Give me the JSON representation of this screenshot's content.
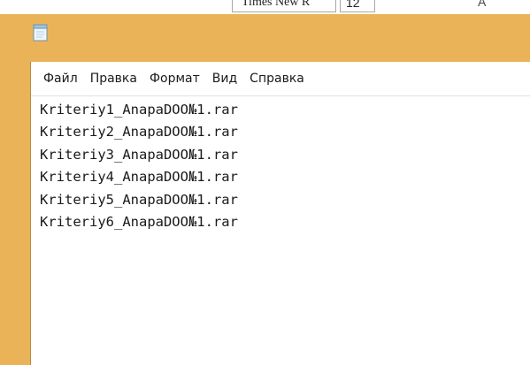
{
  "background_app": {
    "font_combo_value": "Times New R",
    "font_size_value": "12",
    "extra_glyph": "A"
  },
  "notepad": {
    "icon": "notepad-icon",
    "menu": [
      {
        "label": "Файл"
      },
      {
        "label": "Правка"
      },
      {
        "label": "Формат"
      },
      {
        "label": "Вид"
      },
      {
        "label": "Справка"
      }
    ],
    "lines": [
      "Kriteriy1_AnapaDOO№1.rar",
      "Kriteriy2_AnapaDOO№1.rar",
      "Kriteriy3_AnapaDOO№1.rar",
      "Kriteriy4_AnapaDOO№1.rar",
      "Kriteriy5_AnapaDOO№1.rar",
      "Kriteriy6_AnapaDOO№1.rar"
    ]
  },
  "colors": {
    "window_frame": "#ebb358",
    "client_background": "#ffffff",
    "text": "#1a1a1a"
  }
}
